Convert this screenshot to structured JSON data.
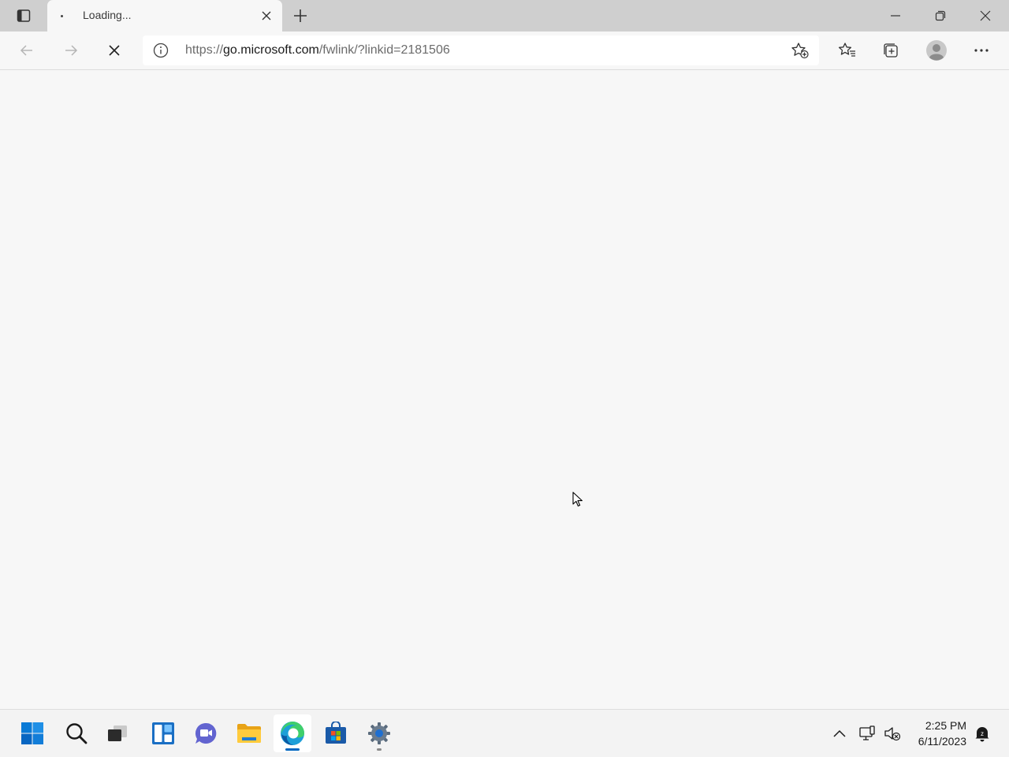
{
  "browser": {
    "tab": {
      "title": "Loading...",
      "favicon": "loading-dot-icon"
    },
    "address_bar": {
      "scheme": "https://",
      "host": "go.microsoft.com",
      "path": "/fwlink/?linkid=2181506",
      "info_icon": "info-icon"
    },
    "toolbar_icons": [
      "back-icon",
      "forward-icon",
      "stop-icon",
      "add-favorite-icon",
      "favorites-icon",
      "collections-icon",
      "profile-icon",
      "more-icon"
    ],
    "caption_icons": [
      "minimize-icon",
      "restore-icon",
      "close-icon"
    ]
  },
  "taskbar": {
    "apps": [
      "start",
      "search",
      "task-view",
      "widgets",
      "chat",
      "file-explorer",
      "edge",
      "store",
      "settings"
    ],
    "active_app": "edge",
    "clock": {
      "time": "2:25 PM",
      "date": "6/11/2023"
    },
    "tray_icons": [
      "chevron-up-icon",
      "network-icon",
      "volume-icon",
      "notification-icon"
    ]
  },
  "colors": {
    "accent": "#0067c0",
    "tabstrip": "#cfcfcf",
    "page_bg": "#f7f7f7",
    "taskbar_bg": "#f3f3f3"
  }
}
